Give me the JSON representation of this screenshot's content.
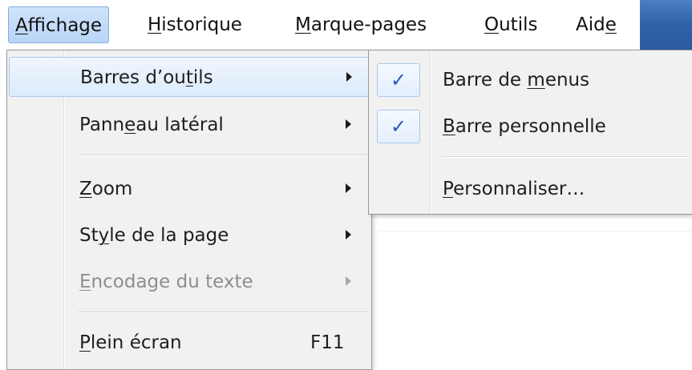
{
  "menubar": {
    "items": [
      {
        "label": "Affichage",
        "u": "A",
        "rest": "ffichage",
        "active": true
      },
      {
        "label": "Historique",
        "u": "H",
        "rest": "istorique"
      },
      {
        "label": "Marque-pages",
        "u": "M",
        "rest": "arque-pages"
      },
      {
        "label": "Outils",
        "u": "O",
        "rest": "utils"
      },
      {
        "label": "Aide",
        "pre": "Aid",
        "u": "e"
      }
    ]
  },
  "menu": {
    "items": [
      {
        "pre": "Barres d’ou",
        "u": "t",
        "post": "ils",
        "label": "Barres d’outils",
        "submenu": true,
        "highlighted": true
      },
      {
        "pre": "Pann",
        "u": "e",
        "post": "au latéral",
        "label": "Panneau latéral",
        "submenu": true
      },
      {
        "pre": "",
        "u": "Z",
        "post": "oom",
        "label": "Zoom",
        "submenu": true
      },
      {
        "pre": "St",
        "u": "y",
        "post": "le de la page",
        "label": "Style de la page",
        "submenu": true
      },
      {
        "pre": "",
        "u": "E",
        "post": "ncodage du texte",
        "label": "Encodage du texte",
        "submenu": true,
        "disabled": true
      },
      {
        "pre": "",
        "u": "P",
        "post": "lein écran",
        "label": "Plein écran",
        "shortcut": "F11"
      }
    ]
  },
  "submenu": {
    "check_glyph": "✓",
    "items": [
      {
        "pre": "Barre de ",
        "u": "m",
        "post": "enus",
        "label": "Barre de menus",
        "checked": true
      },
      {
        "pre": "",
        "u": "B",
        "post": "arre personnelle",
        "label": "Barre personnelle",
        "checked": true
      },
      {
        "pre": "",
        "u": "P",
        "post": "ersonnaliser…",
        "label": "Personnaliser…",
        "checked": false
      }
    ]
  },
  "colors": {
    "menu_bg": "#f1f1f1",
    "highlight_border": "#a8c8ee",
    "check_color": "#2a56b8",
    "disabled_text": "#8e8e8e",
    "titlebar_blue": "#2e63a8"
  }
}
